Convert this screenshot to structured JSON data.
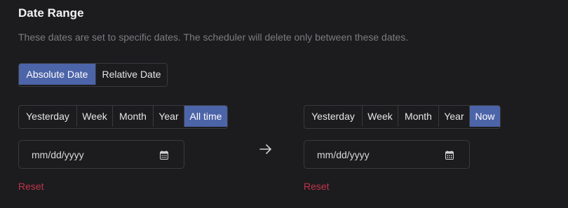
{
  "section": {
    "title": "Date Range",
    "description": "These dates are set to specific dates. The scheduler will delete only between these dates."
  },
  "mode": {
    "options": [
      "Absolute Date",
      "Relative Date"
    ],
    "selected": "Absolute Date"
  },
  "start": {
    "presets": [
      "Yesterday",
      "Week",
      "Month",
      "Year",
      "All time"
    ],
    "selected": "All time",
    "date_value": "mm/dd/yyyy",
    "reset_label": "Reset"
  },
  "end": {
    "presets": [
      "Yesterday",
      "Week",
      "Month",
      "Year",
      "Now"
    ],
    "selected": "Now",
    "date_value": "mm/dd/yyyy",
    "reset_label": "Reset"
  },
  "colors": {
    "accent": "#4c64a8",
    "danger": "#c0334a",
    "background": "#1c1c1e"
  }
}
